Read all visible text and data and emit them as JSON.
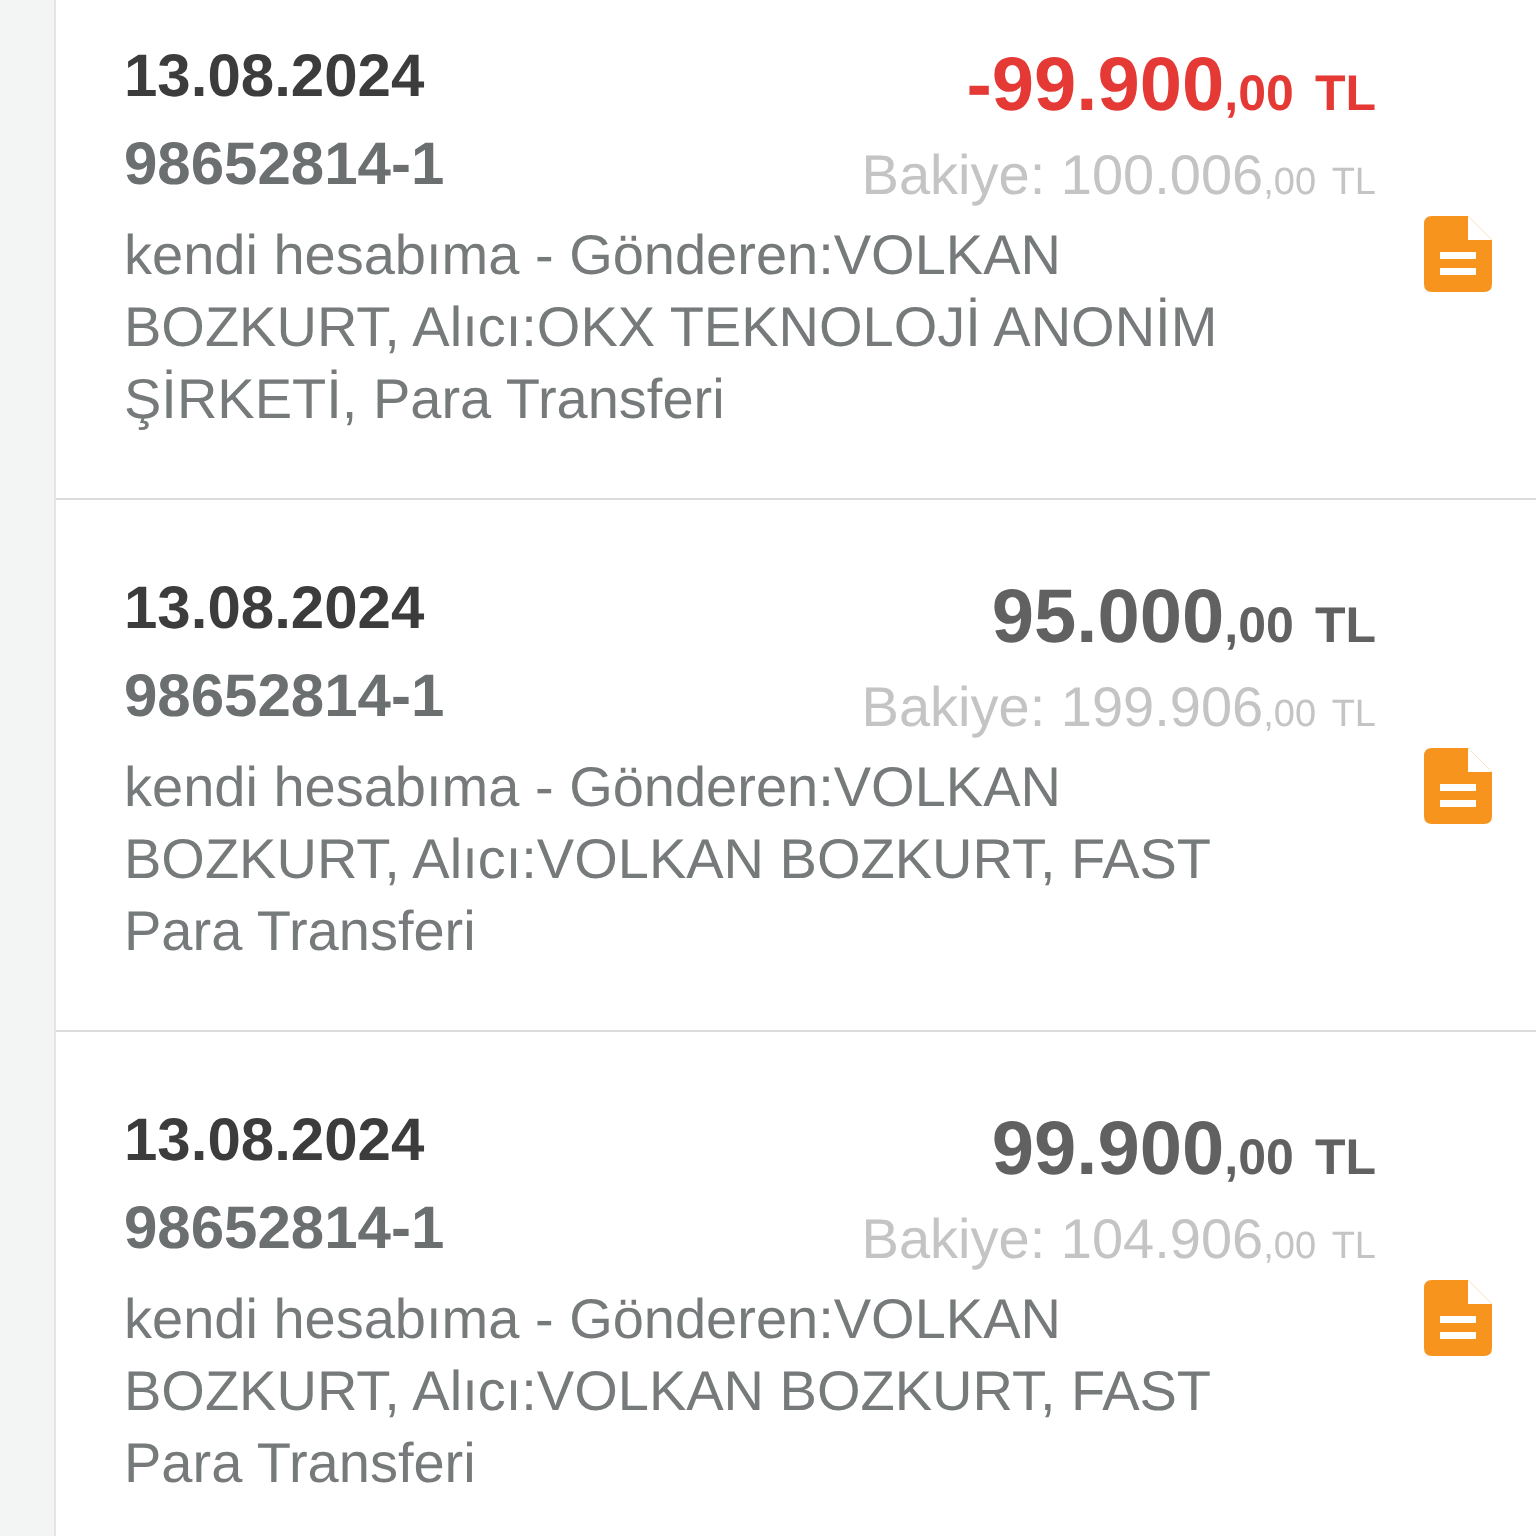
{
  "transactions": [
    {
      "date": "13.08.2024",
      "reference": "98652814-1",
      "kind": "debit",
      "amount": "-99.900",
      "amount_fraction": ",00",
      "currency": "TL",
      "balance_label": "Bakiye:",
      "balance": "100.006",
      "balance_fraction": ",00",
      "balance_currency": "TL",
      "description": "kendi hesabıma - Gönderen:VOLKAN BOZKURT, Alıcı:OKX TEKNOLOJİ ANONİM ŞİRKETİ, Para Transferi"
    },
    {
      "date": "13.08.2024",
      "reference": "98652814-1",
      "kind": "credit",
      "amount": "95.000",
      "amount_fraction": ",00",
      "currency": "TL",
      "balance_label": "Bakiye:",
      "balance": "199.906",
      "balance_fraction": ",00",
      "balance_currency": "TL",
      "description": "kendi hesabıma - Gönderen:VOLKAN BOZKURT, Alıcı:VOLKAN BOZKURT, FAST Para Transferi"
    },
    {
      "date": "13.08.2024",
      "reference": "98652814-1",
      "kind": "credit",
      "amount": "99.900",
      "amount_fraction": ",00",
      "currency": "TL",
      "balance_label": "Bakiye:",
      "balance": "104.906",
      "balance_fraction": ",00",
      "balance_currency": "TL",
      "description": "kendi hesabıma - Gönderen:VOLKAN BOZKURT, Alıcı:VOLKAN BOZKURT, FAST Para Transferi"
    }
  ]
}
